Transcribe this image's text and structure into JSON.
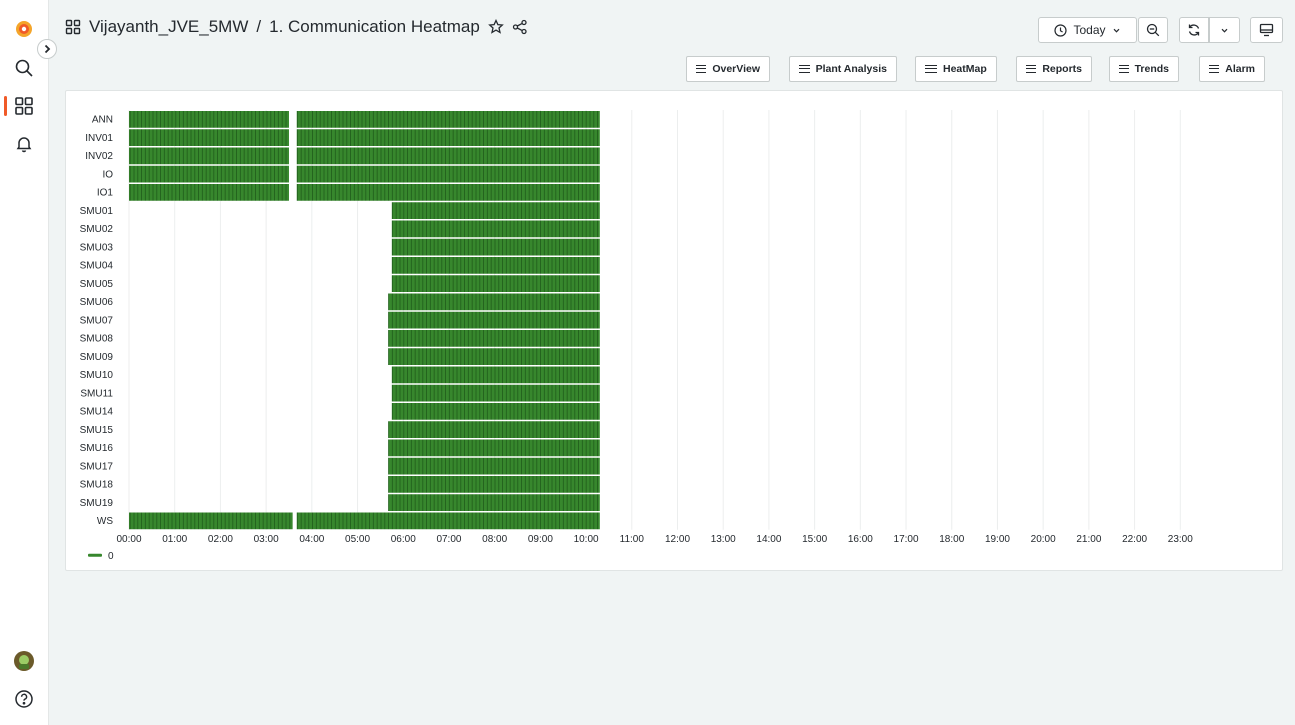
{
  "breadcrumb": {
    "folder": "Vijayanth_JVE_5MW",
    "separator": "/",
    "dashboard": "1. Communication Heatmap"
  },
  "time_picker": {
    "label": "Today"
  },
  "nav_links": [
    {
      "label": "OverView"
    },
    {
      "label": "Plant Analysis"
    },
    {
      "label": "HeatMap"
    },
    {
      "label": "Reports"
    },
    {
      "label": "Trends"
    },
    {
      "label": "Alarm"
    }
  ],
  "icons": {
    "logo": "grafana-logo-icon",
    "search": "search-icon",
    "dashboards": "dashboards-grid-icon",
    "alerts": "bell-icon",
    "avatar": "avatar-icon",
    "help": "help-icon",
    "star": "star-icon",
    "share": "share-icon",
    "zoom_out": "zoom-out-icon",
    "refresh": "refresh-icon",
    "tv": "tv-mode-icon"
  },
  "colors": {
    "accent": "#f05a28",
    "cell": "#37872d",
    "cell_dark": "#1f5c1a"
  },
  "chart_data": {
    "type": "heatmap",
    "rows": [
      "ANN",
      "INV01",
      "INV02",
      "IO",
      "IO1",
      "SMU01",
      "SMU02",
      "SMU03",
      "SMU04",
      "SMU05",
      "SMU06",
      "SMU07",
      "SMU08",
      "SMU09",
      "SMU10",
      "SMU11",
      "SMU14",
      "SMU15",
      "SMU16",
      "SMU17",
      "SMU18",
      "SMU19",
      "WS"
    ],
    "x_ticks": [
      "00:00",
      "01:00",
      "02:00",
      "03:00",
      "04:00",
      "05:00",
      "06:00",
      "07:00",
      "08:00",
      "09:00",
      "10:00",
      "11:00",
      "12:00",
      "13:00",
      "14:00",
      "15:00",
      "16:00",
      "17:00",
      "18:00",
      "19:00",
      "20:00",
      "21:00",
      "22:00",
      "23:00"
    ],
    "x_range_hours": [
      0,
      24
    ],
    "value": 0,
    "legend": [
      {
        "name": "0",
        "color": "#37872d"
      }
    ],
    "legend_placement": "bottom-left",
    "grid": true,
    "row_data_hours": {
      "ANN": [
        [
          0.0,
          3.5
        ],
        [
          3.67,
          10.3
        ]
      ],
      "INV01": [
        [
          0.0,
          3.5
        ],
        [
          3.67,
          10.3
        ]
      ],
      "INV02": [
        [
          0.0,
          3.5
        ],
        [
          3.67,
          10.3
        ]
      ],
      "IO": [
        [
          0.0,
          3.5
        ],
        [
          3.67,
          10.3
        ]
      ],
      "IO1": [
        [
          0.0,
          3.5
        ],
        [
          3.67,
          10.3
        ]
      ],
      "SMU01": [
        [
          5.75,
          10.3
        ]
      ],
      "SMU02": [
        [
          5.75,
          10.3
        ]
      ],
      "SMU03": [
        [
          5.75,
          10.3
        ]
      ],
      "SMU04": [
        [
          5.75,
          10.3
        ]
      ],
      "SMU05": [
        [
          5.75,
          10.3
        ]
      ],
      "SMU06": [
        [
          5.67,
          10.3
        ]
      ],
      "SMU07": [
        [
          5.67,
          10.3
        ]
      ],
      "SMU08": [
        [
          5.67,
          10.3
        ]
      ],
      "SMU09": [
        [
          5.67,
          10.3
        ]
      ],
      "SMU10": [
        [
          5.75,
          10.3
        ]
      ],
      "SMU11": [
        [
          5.75,
          10.3
        ]
      ],
      "SMU14": [
        [
          5.75,
          10.3
        ]
      ],
      "SMU15": [
        [
          5.67,
          10.3
        ]
      ],
      "SMU16": [
        [
          5.67,
          10.3
        ]
      ],
      "SMU17": [
        [
          5.67,
          10.3
        ]
      ],
      "SMU18": [
        [
          5.67,
          10.3
        ]
      ],
      "SMU19": [
        [
          5.67,
          10.3
        ]
      ],
      "WS": [
        [
          0.0,
          3.58
        ],
        [
          3.67,
          10.3
        ]
      ]
    }
  }
}
